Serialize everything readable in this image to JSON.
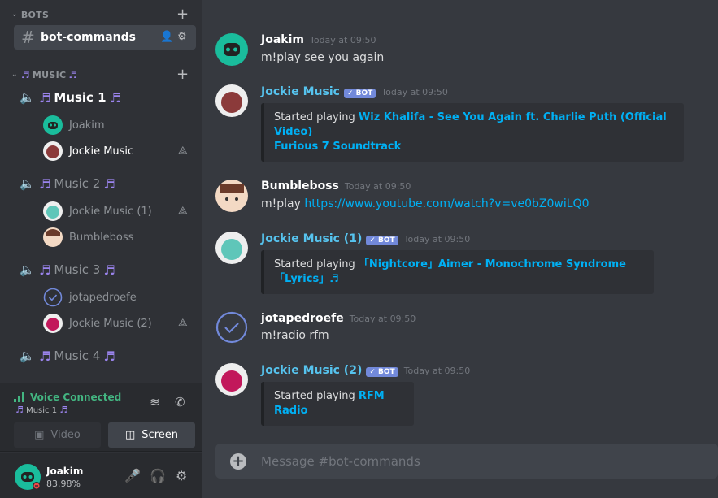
{
  "sidebar": {
    "bots_category": "BOTS",
    "text_channel": "bot-commands",
    "music_category": "MUSIC",
    "voice_channels": [
      {
        "name": "Music 1",
        "active": true,
        "users": [
          {
            "name": "Joakim",
            "muted_deaf": false,
            "active": false
          },
          {
            "name": "Jockie Music",
            "muted_deaf": true,
            "active": true
          }
        ]
      },
      {
        "name": "Music 2",
        "active": false,
        "users": [
          {
            "name": "Jockie Music (1)",
            "muted_deaf": true,
            "active": false
          },
          {
            "name": "Bumbleboss",
            "muted_deaf": false,
            "active": false
          }
        ]
      },
      {
        "name": "Music 3",
        "active": false,
        "users": [
          {
            "name": "jotapedroefe",
            "muted_deaf": false,
            "active": false
          },
          {
            "name": "Jockie Music (2)",
            "muted_deaf": true,
            "active": false
          }
        ]
      },
      {
        "name": "Music 4",
        "active": false,
        "users": []
      }
    ],
    "voice_status": {
      "title": "Voice Connected",
      "channel": "Music 1"
    },
    "video_label": "Video",
    "screen_label": "Screen",
    "user": {
      "name": "Joakim",
      "status": "83.98%"
    }
  },
  "messages": [
    {
      "author": "Joakim",
      "bot": false,
      "time": "Today at 09:50",
      "text": "m!play see you again"
    },
    {
      "author": "Jockie Music",
      "bot": true,
      "time": "Today at 09:50",
      "embed_prefix": "Started playing ",
      "embed_title_line1": "Wiz Khalifa - See You Again ft. Charlie Puth (Official Video)",
      "embed_title_line2": "Furious 7 Soundtrack"
    },
    {
      "author": "Bumbleboss",
      "bot": false,
      "time": "Today at 09:50",
      "text": "m!play ",
      "link": "https://www.youtube.com/watch?v=ve0bZ0wiLQ0"
    },
    {
      "author": "Jockie Music (1)",
      "bot": true,
      "time": "Today at 09:50",
      "embed_prefix": "Started playing ",
      "embed_title_line1": "「Nightcore」Aimer - Monochrome Syndrome「Lyrics」♬"
    },
    {
      "author": "jotapedroefe",
      "bot": false,
      "time": "Today at 09:50",
      "text": "m!radio rfm"
    },
    {
      "author": "Jockie Music (2)",
      "bot": true,
      "time": "Today at 09:50",
      "embed_prefix": "Started playing ",
      "embed_title_line1": "RFM Radio"
    }
  ],
  "bot_badge": "✓ BOT",
  "composer": {
    "placeholder": "Message #bot-commands"
  },
  "icons": [
    "chevron-down-icon",
    "plus-icon",
    "hash-icon",
    "invite-icon",
    "gear-icon",
    "speaker-icon",
    "music-note-icon",
    "deafened-icon",
    "signal-icon",
    "disconnect-icon",
    "noise-icon",
    "video-icon",
    "screen-share-icon",
    "microphone-icon",
    "headphones-icon",
    "check-circle-icon"
  ],
  "colors": {
    "accent": "#7289da",
    "link": "#00b0f4",
    "bot_name": "#56c3ee",
    "voice_green": "#43b581",
    "music_note": "#9b84ee"
  }
}
